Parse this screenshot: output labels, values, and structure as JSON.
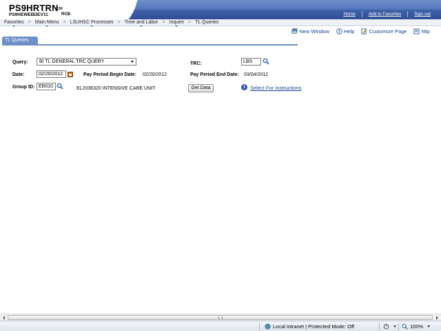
{
  "header": {
    "app_title": "PS9HRTRN",
    "version": "8.50",
    "database": "PS9HEWEBDEV11",
    "user_code": "RCB",
    "links": [
      "Home",
      "Add to Favorites",
      "Sign out"
    ]
  },
  "nav": {
    "items": [
      {
        "label": "Favorites",
        "dropdown": true
      },
      {
        "label": "Main Menu",
        "dropdown": true
      },
      {
        "label": "LSUHSC Processes",
        "dropdown": true
      },
      {
        "label": "Time and Labor",
        "dropdown": true
      },
      {
        "label": "Inquire",
        "dropdown": true
      },
      {
        "label": "TL Queries",
        "dropdown": false
      }
    ],
    "separator": ">"
  },
  "page_tools": {
    "new_window": "New Window",
    "help": "Help",
    "customize_page": "Customize Page",
    "http": "http"
  },
  "tab": {
    "label": "TL Queries"
  },
  "form": {
    "query_label": "Query:",
    "query_value": "BI TL GENERAL TRC QUERY",
    "trc_label": "TRC:",
    "trc_value": "LBS",
    "date_label": "Date:",
    "date_value": "02/20/2012",
    "begin_label": "Pay Period Begin Date:",
    "begin_value": "02/20/2012",
    "end_label": "Pay Period End Date:",
    "end_value": "03/04/2012",
    "group_label": "Group ID:",
    "group_value": "EB010",
    "group_desc": "EL2036320 INTENSIVE CARE UNIT",
    "get_data_button": "Get Data",
    "instructions_link": "Select For Instructions"
  },
  "status_bar": {
    "zone": "Local intranet | Protected Mode: Off",
    "zoom": "100%"
  },
  "colors": {
    "header_blue": "#3d5fa6",
    "tab_blue": "#6d8fc7",
    "link_blue": "#1a3f8e"
  }
}
